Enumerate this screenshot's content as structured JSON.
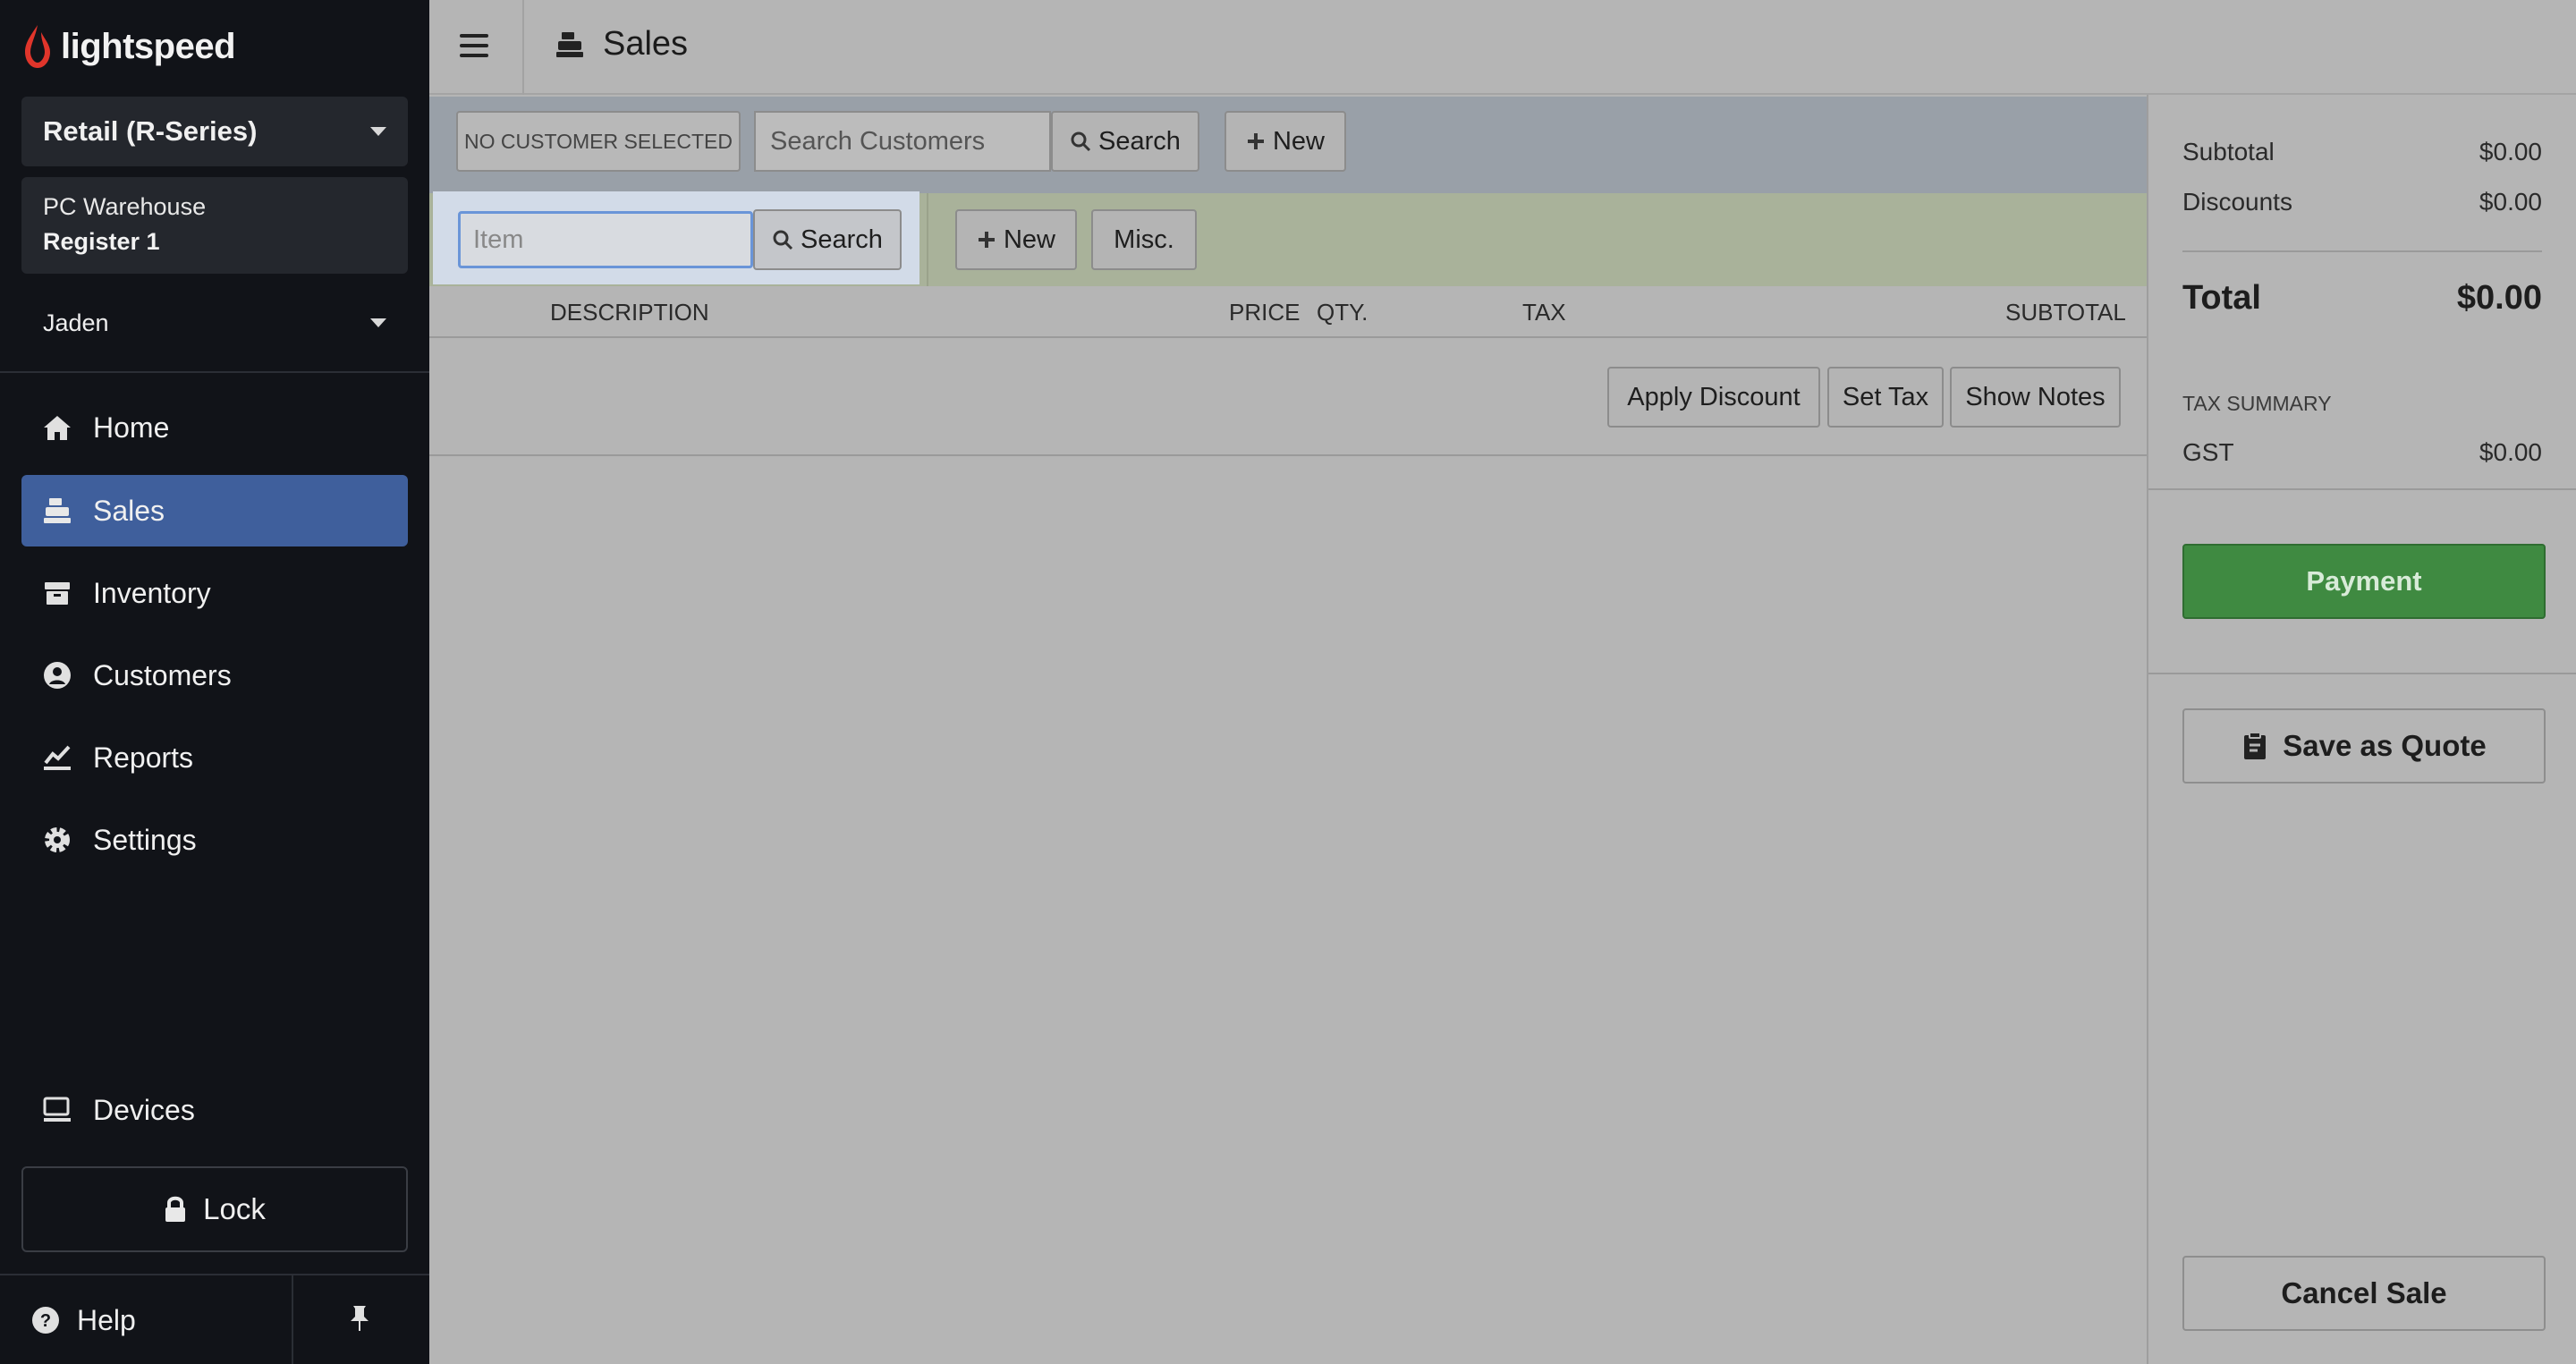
{
  "sidebar": {
    "logo_text": "lightspeed",
    "store_select": "Retail (R-Series)",
    "location": "PC Warehouse",
    "register": "Register 1",
    "user": "Jaden",
    "nav": {
      "home": "Home",
      "sales": "Sales",
      "inventory": "Inventory",
      "customers": "Customers",
      "reports": "Reports",
      "settings": "Settings",
      "devices": "Devices"
    },
    "lock_label": "Lock",
    "help_label": "Help"
  },
  "topbar": {
    "title": "Sales"
  },
  "customer_bar": {
    "status": "NO CUSTOMER SELECTED",
    "search_placeholder": "Search Customers",
    "search_button": "Search",
    "new_button": "New"
  },
  "item_bar": {
    "item_placeholder": "Item",
    "search_button": "Search",
    "new_button": "New",
    "misc_button": "Misc."
  },
  "table": {
    "columns": {
      "description": "DESCRIPTION",
      "price": "PRICE",
      "qty": "QTY.",
      "tax": "TAX",
      "subtotal": "SUBTOTAL"
    }
  },
  "actions": {
    "apply_discount": "Apply Discount",
    "set_tax": "Set Tax",
    "show_notes": "Show Notes"
  },
  "summary": {
    "subtotal_label": "Subtotal",
    "subtotal_value": "$0.00",
    "discounts_label": "Discounts",
    "discounts_value": "$0.00",
    "total_label": "Total",
    "total_value": "$0.00",
    "tax_summary_label": "TAX SUMMARY",
    "gst_label": "GST",
    "gst_value": "$0.00",
    "payment_button": "Payment",
    "quote_button": "Save as Quote",
    "cancel_button": "Cancel Sale"
  },
  "colors": {
    "sidebar_bg": "#111318",
    "active_nav": "#3f5f9c",
    "payment_green": "#3f8a41",
    "logo_red": "#e0352b"
  }
}
